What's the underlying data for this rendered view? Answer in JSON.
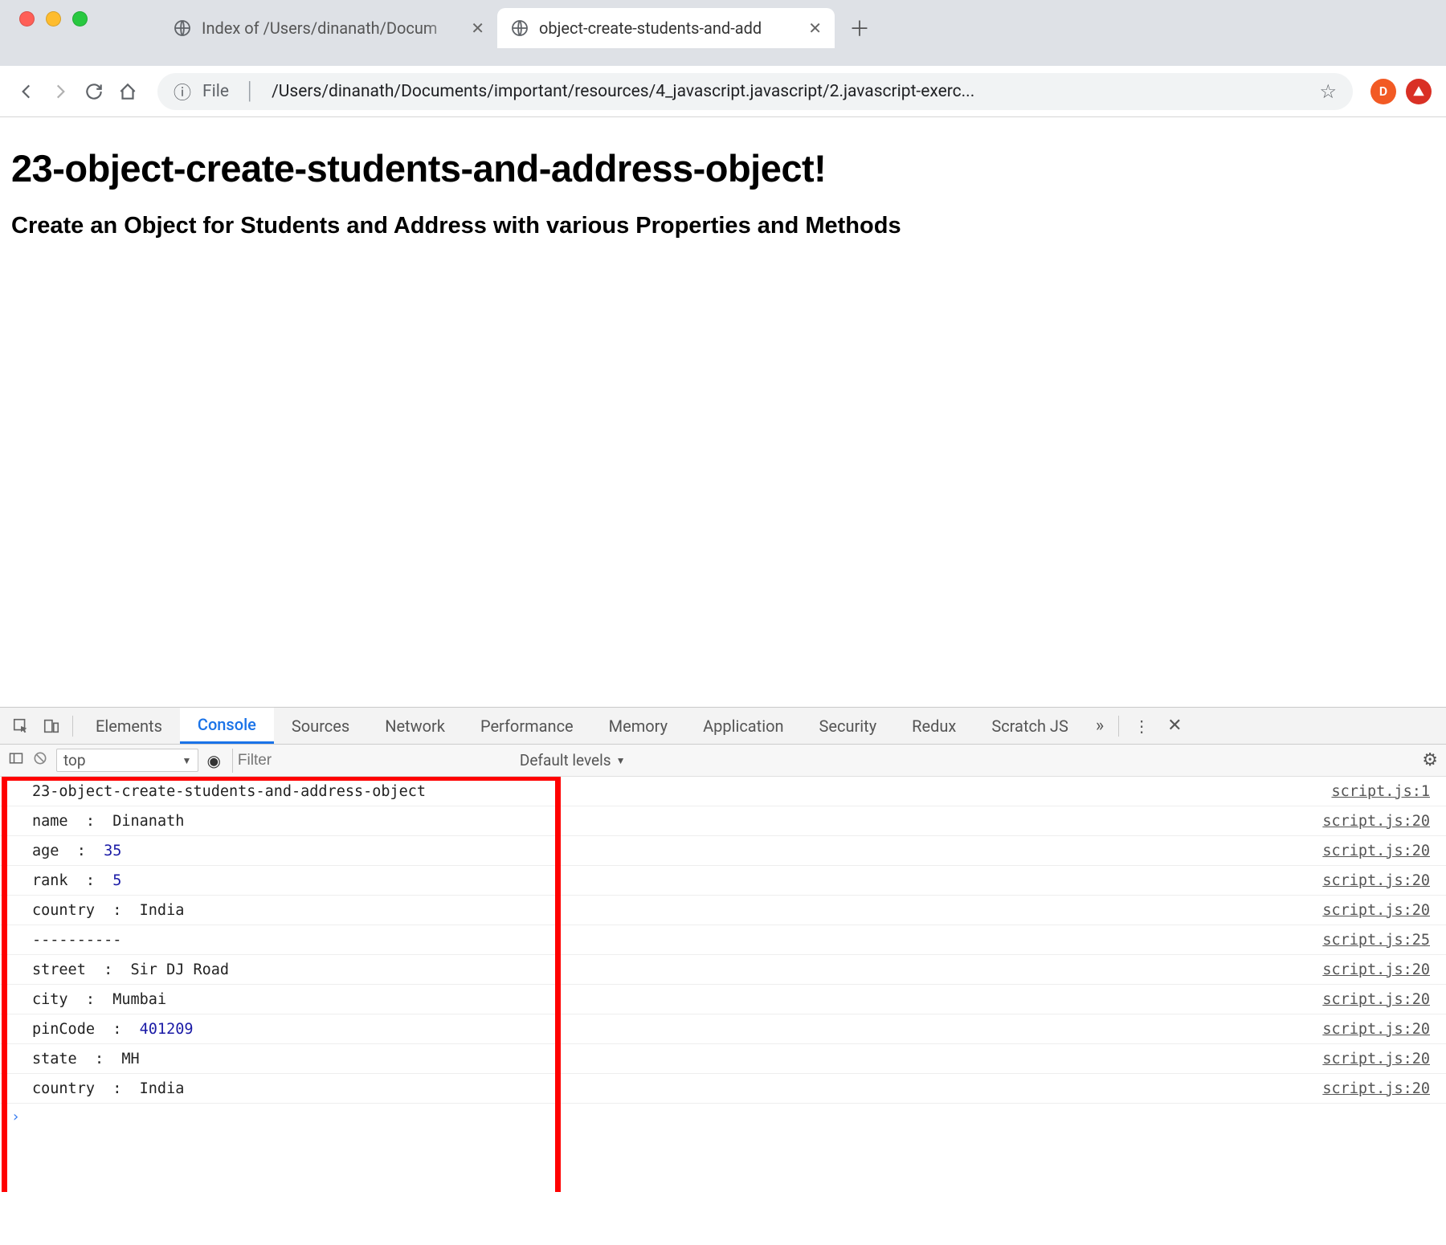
{
  "browser": {
    "tabs": [
      {
        "title": "Index of /Users/dinanath/Docum",
        "active": false
      },
      {
        "title": "object-create-students-and-add",
        "active": true
      }
    ],
    "url_scheme": "File",
    "url_path": "/Users/dinanath/Documents/important/resources/4_javascript.javascript/2.javascript-exerc...",
    "avatar_letter": "D"
  },
  "page": {
    "h1": "23-object-create-students-and-address-object!",
    "h2": "Create an Object for Students and Address with various Properties and Methods"
  },
  "devtools": {
    "tabs": [
      "Elements",
      "Console",
      "Sources",
      "Network",
      "Performance",
      "Memory",
      "Application",
      "Security",
      "Redux",
      "Scratch JS"
    ],
    "active_tab": "Console",
    "context": "top",
    "filter_placeholder": "Filter",
    "levels": "Default levels",
    "console_lines": [
      {
        "text": "23-object-create-students-and-address-object",
        "src": "script.js:1"
      },
      {
        "key": "name",
        "val": "Dinanath",
        "num": false,
        "src": "script.js:20"
      },
      {
        "key": "age",
        "val": "35",
        "num": true,
        "src": "script.js:20"
      },
      {
        "key": "rank",
        "val": "5",
        "num": true,
        "src": "script.js:20"
      },
      {
        "key": "country",
        "val": "India",
        "num": false,
        "src": "script.js:20"
      },
      {
        "text": "----------",
        "src": "script.js:25"
      },
      {
        "key": "street",
        "val": "Sir DJ Road",
        "num": false,
        "src": "script.js:20"
      },
      {
        "key": "city",
        "val": "Mumbai",
        "num": false,
        "src": "script.js:20"
      },
      {
        "key": "pinCode",
        "val": "401209",
        "num": true,
        "src": "script.js:20"
      },
      {
        "key": "state",
        "val": "MH",
        "num": false,
        "src": "script.js:20"
      },
      {
        "key": "country",
        "val": "India",
        "num": false,
        "src": "script.js:20"
      }
    ]
  }
}
